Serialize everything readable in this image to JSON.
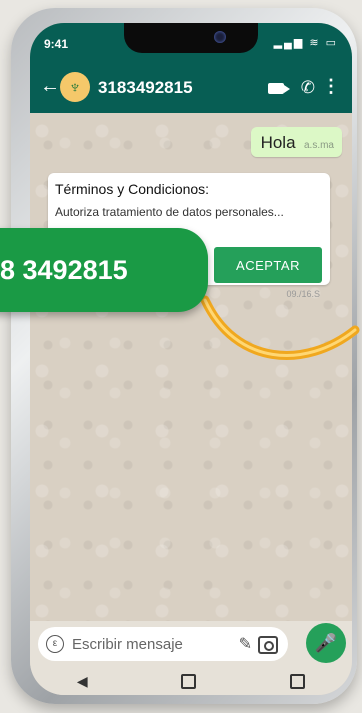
{
  "status_bar": {
    "time": "9:41",
    "icons": "▂▄▆ ≋ ▭"
  },
  "header": {
    "contact_name": "3183492815",
    "back_glyph": "←",
    "phone_glyph": "✆",
    "menu_glyph": "⋮",
    "avatar_glyph": "♆"
  },
  "messages": {
    "outgoing": {
      "text": "Hola",
      "time": "a.s.ma"
    },
    "incoming": {
      "title": "Términos y Condicionos:",
      "body": "Autoriza tratamiento de datos personales...",
      "button_label": "ACEPTAR",
      "time": "09./16.S"
    }
  },
  "input": {
    "placeholder": "Escribir mensaje",
    "emoji_glyph": "ε",
    "clip_glyph": "✎",
    "mic_glyph": "🎤"
  },
  "navbar": {
    "back_glyph": "◀"
  },
  "overlay_badge": {
    "text": "8 3492815"
  },
  "colors": {
    "header": "#075e54",
    "accent_green": "#25a05a",
    "badge_green": "#1a9a45",
    "arrow": "#f0a81f"
  }
}
